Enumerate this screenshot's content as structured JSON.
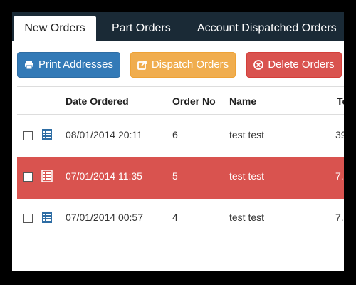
{
  "tabs": [
    {
      "label": "New Orders",
      "active": true
    },
    {
      "label": "Part Orders",
      "active": false
    },
    {
      "label": "Account Dispatched Orders",
      "active": false
    }
  ],
  "toolbar": {
    "print_label": "Print Addresses",
    "dispatch_label": "Dispatch Orders",
    "delete_label": "Delete Orders"
  },
  "table": {
    "headers": [
      "Date Ordered",
      "Order No",
      "Name",
      "To"
    ],
    "rows": [
      {
        "date": "08/01/2014 20:11",
        "order_no": "6",
        "name": "test test",
        "total": "39",
        "selected": false
      },
      {
        "date": "07/01/2014 11:35",
        "order_no": "5",
        "name": "test test",
        "total": "7.",
        "selected": true
      },
      {
        "date": "07/01/2014 00:57",
        "order_no": "4",
        "name": "test test",
        "total": "7.",
        "selected": false
      }
    ]
  },
  "colors": {
    "tabbar_bg": "#1a2a36",
    "primary": "#337ab7",
    "warning": "#f0ad4e",
    "danger": "#d9534f",
    "icon_blue": "#2e6da4"
  }
}
